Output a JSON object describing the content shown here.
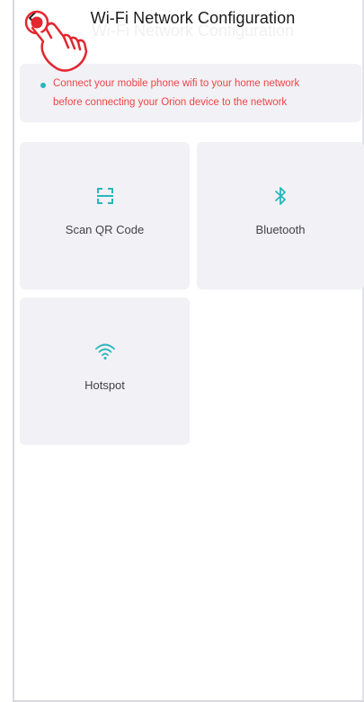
{
  "header": {
    "title": "Wi-Fi Network Configuration",
    "back_icon": "chevron-left-icon"
  },
  "notice": {
    "line1": "Connect your mobile phone wifi to your home network",
    "line2": "before connecting your Orion device to the network",
    "dot_color": "#27b7bb",
    "text_color": "#ef4545"
  },
  "options": [
    {
      "label": "Scan QR Code",
      "icon": "scan-qr-icon"
    },
    {
      "label": "Bluetooth",
      "icon": "bluetooth-icon"
    },
    {
      "label": "Hotspot",
      "icon": "wifi-icon"
    }
  ],
  "accent_color": "#27b7bb",
  "overlay": {
    "icon": "tap-hand-icon",
    "color": "#e3262f"
  }
}
